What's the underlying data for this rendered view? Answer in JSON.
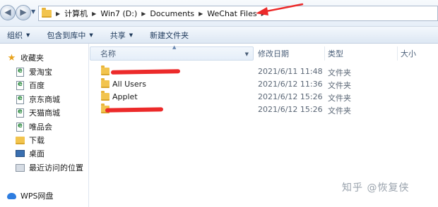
{
  "address": {
    "crumbs": [
      "计算机",
      "Win7 (D:)",
      "Documents",
      "WeChat Files"
    ]
  },
  "toolbar": {
    "organize": "组织",
    "include_in_library": "包含到库中",
    "share": "共享",
    "new_folder": "新建文件夹"
  },
  "sidebar": {
    "favorites": "收藏夹",
    "items": [
      "爱淘宝",
      "百度",
      "京东商城",
      "天猫商城",
      "唯品会",
      "下载",
      "桌面",
      "最近访问的位置"
    ],
    "wps": "WPS网盘"
  },
  "columns": {
    "name": "名称",
    "date": "修改日期",
    "type": "类型",
    "size": "大小"
  },
  "files": [
    {
      "name": "",
      "date": "2021/6/11 11:48",
      "type": "文件夹",
      "redacted": true
    },
    {
      "name": "All Users",
      "date": "2021/6/12 11:36",
      "type": "文件夹",
      "redacted": false
    },
    {
      "name": "Applet",
      "date": "2021/6/12 15:26",
      "type": "文件夹",
      "redacted": false
    },
    {
      "name": "",
      "date": "2021/6/12 15:26",
      "type": "文件夹",
      "redacted": true
    }
  ],
  "watermark": "知乎 @恢复侠",
  "colors": {
    "annotation": "#ec2a2a",
    "folder": "#f2c44e",
    "toolbar_text": "#1e395b"
  }
}
